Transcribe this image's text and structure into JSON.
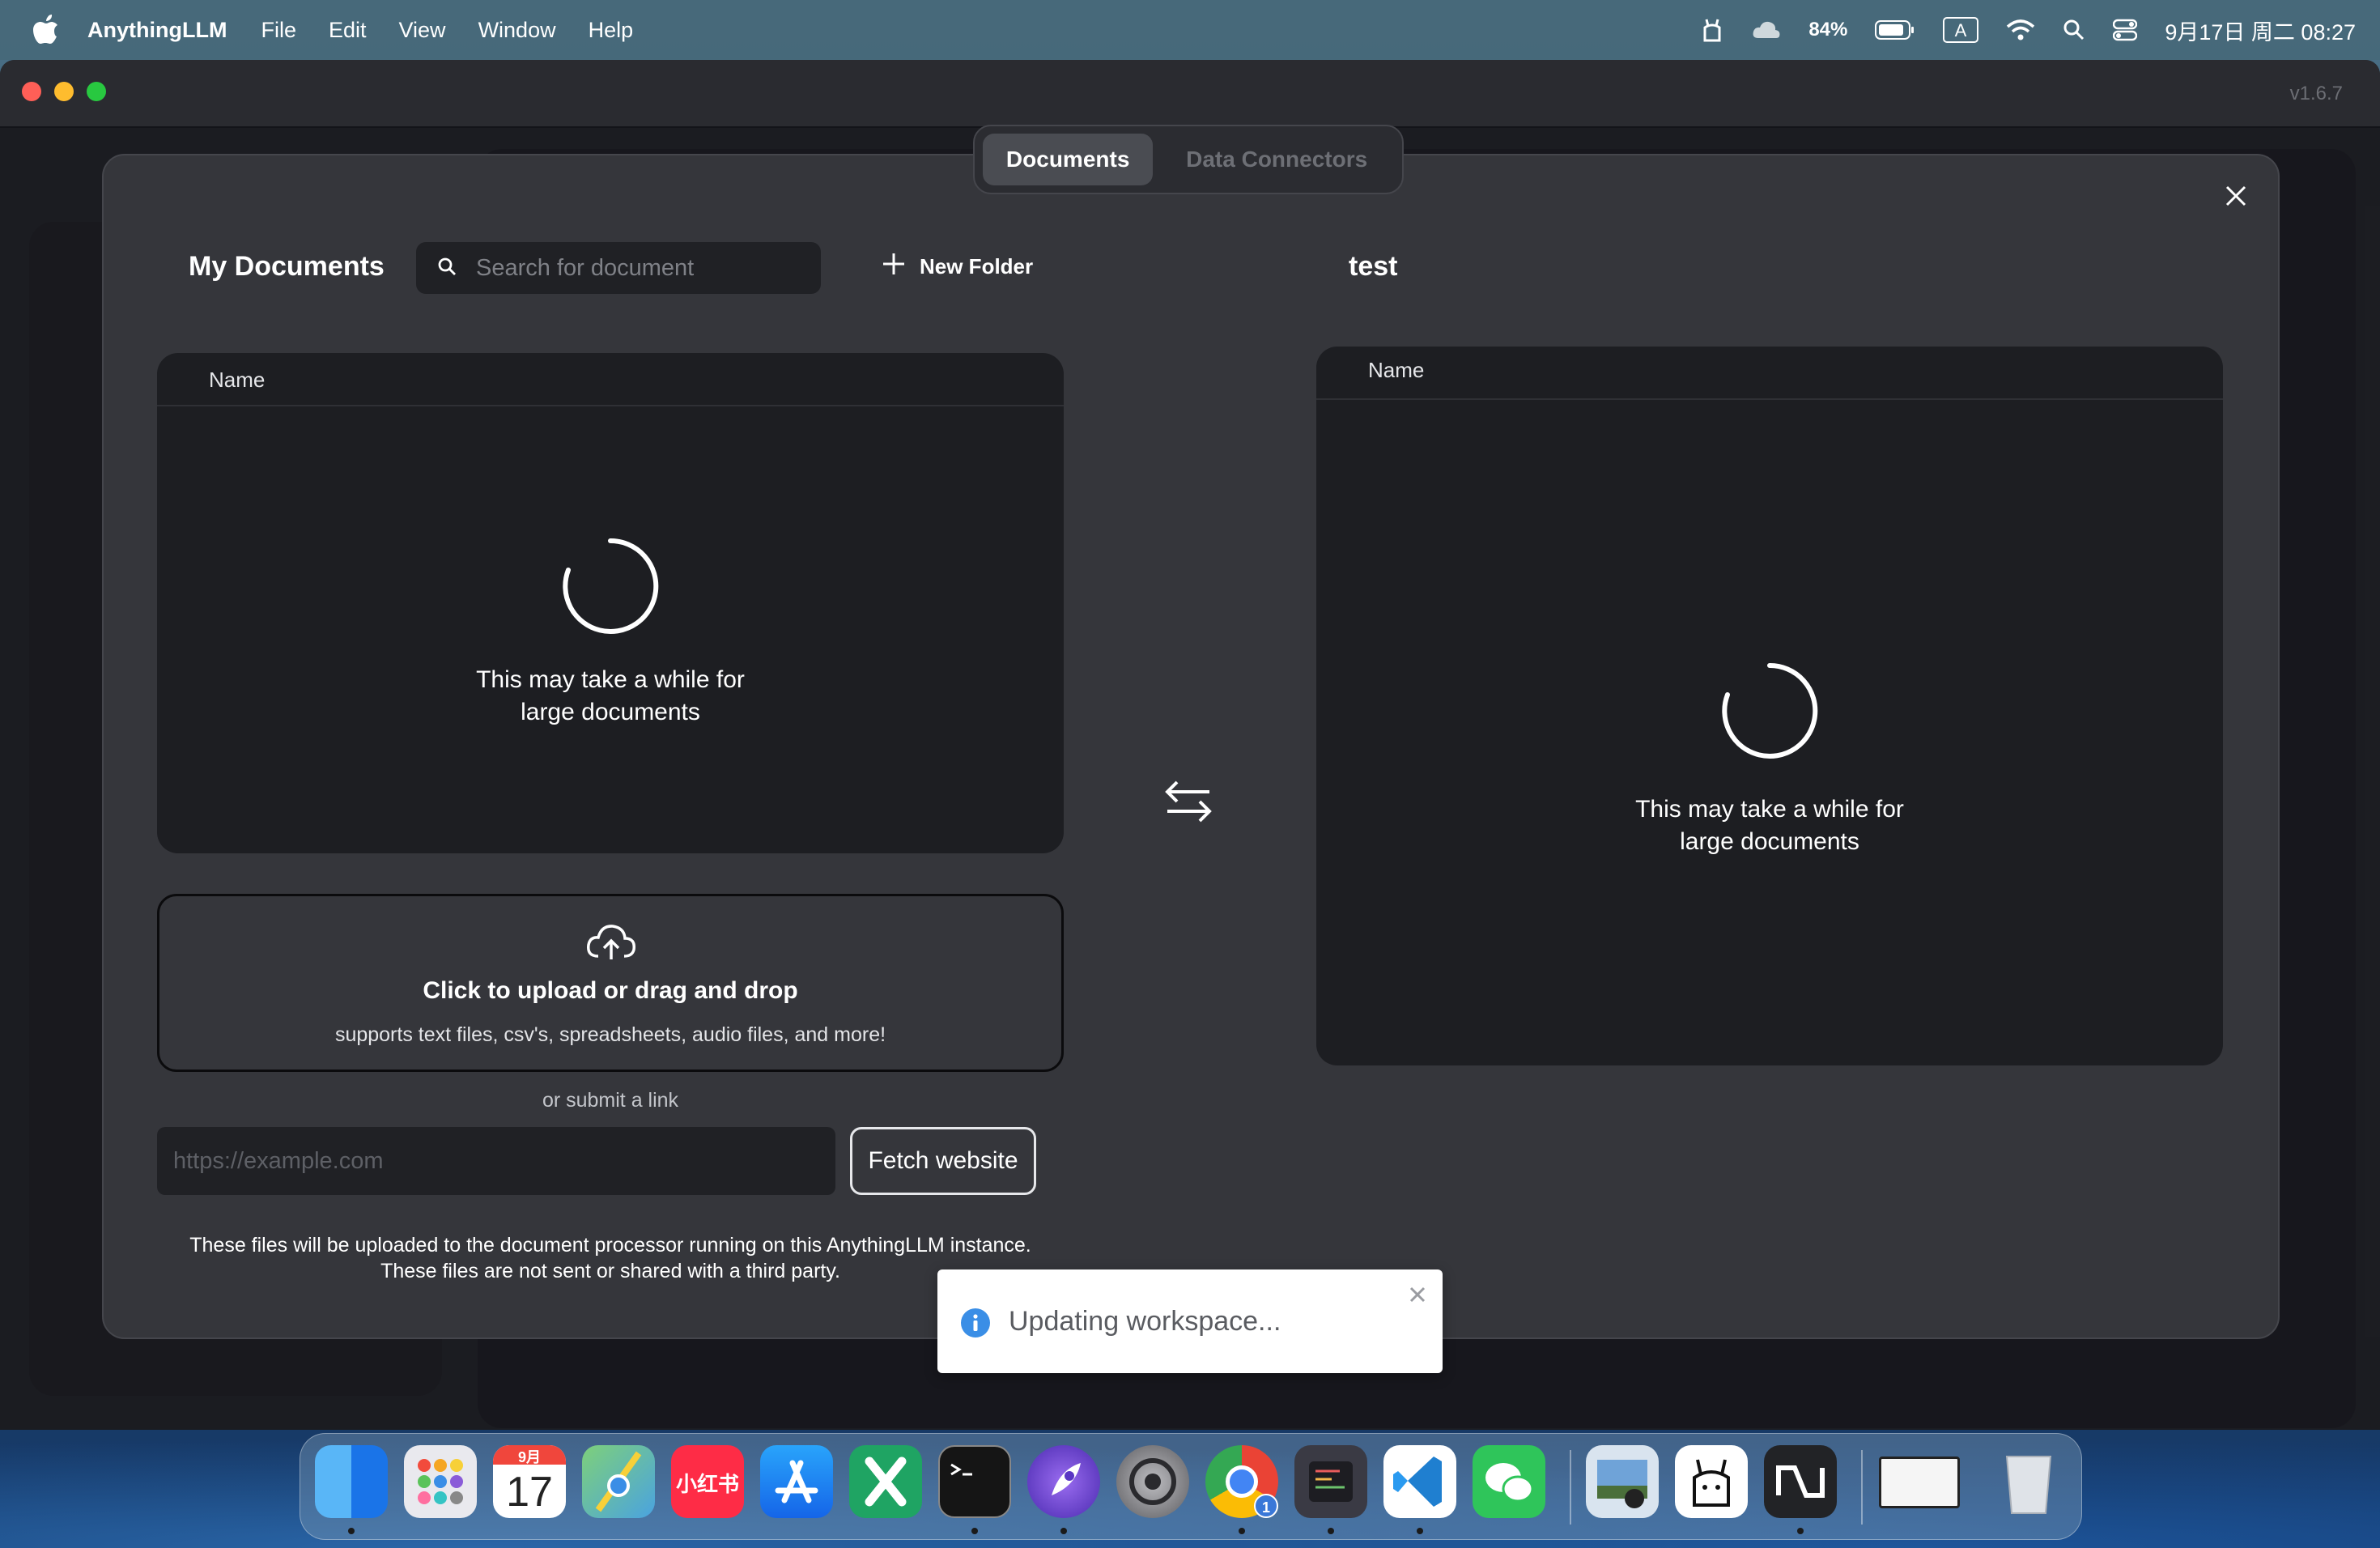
{
  "menubar": {
    "app_name": "AnythingLLM",
    "menus": [
      "File",
      "Edit",
      "View",
      "Window",
      "Help"
    ],
    "battery": "84%",
    "input_method": "A",
    "clock": "9月17日 周二 08:27"
  },
  "window": {
    "version": "v1.6.7"
  },
  "modal": {
    "tabs": [
      {
        "label": "Documents",
        "active": true
      },
      {
        "label": "Data Connectors",
        "active": false
      }
    ],
    "my_documents_title": "My Documents",
    "search_placeholder": "Search for document",
    "new_folder_label": "New Folder",
    "workspace_name": "test",
    "left_panel": {
      "column_header": "Name",
      "loading_line1": "This may take a while for",
      "loading_line2": "large documents"
    },
    "right_panel": {
      "column_header": "Name",
      "loading_line1": "This may take a while for",
      "loading_line2": "large documents"
    },
    "upload": {
      "title": "Click to upload or drag and drop",
      "subtitle": "supports text files, csv's, spreadsheets, audio files, and more!"
    },
    "or_submit_link": "or submit a link",
    "url_placeholder": "https://example.com",
    "fetch_button": "Fetch website",
    "disclaimer_line1": "These files will be uploaded to the document processor running on this AnythingLLM instance.",
    "disclaimer_line2": "These files are not sent or shared with a third party."
  },
  "toast": {
    "message": "Updating workspace..."
  },
  "dock": {
    "calendar_month": "9月",
    "calendar_day": "17",
    "xiaohongshu_label": "小红书",
    "chrome_badge": "1",
    "items": [
      {
        "name": "finder",
        "color": "#3d8ff0"
      },
      {
        "name": "launchpad",
        "color": "#e9e9ee"
      },
      {
        "name": "calendar",
        "color": "#ffffff"
      },
      {
        "name": "maps",
        "color": "#62b861"
      },
      {
        "name": "xiaohongshu",
        "color": "#fe2c46"
      },
      {
        "name": "app-store",
        "color": "#1a7cf5"
      },
      {
        "name": "excel",
        "color": "#1fa463"
      },
      {
        "name": "terminal",
        "color": "#151515"
      },
      {
        "name": "rocket",
        "color": "#6b3bd6"
      },
      {
        "name": "system-settings",
        "color": "#8b8b8e"
      },
      {
        "name": "chrome",
        "color": "#ffffff"
      },
      {
        "name": "editor",
        "color": "#3a3a44"
      },
      {
        "name": "vscode",
        "color": "#ffffff"
      },
      {
        "name": "wechat",
        "color": "#2fc55a"
      },
      {
        "name": "preview",
        "color": "#d9e4ef"
      },
      {
        "name": "ollama",
        "color": "#ffffff"
      },
      {
        "name": "anythingllm",
        "color": "#222326"
      },
      {
        "name": "window-thumb",
        "color": "#f5f5f5"
      },
      {
        "name": "trash",
        "color": "#dfe3e8"
      }
    ]
  }
}
